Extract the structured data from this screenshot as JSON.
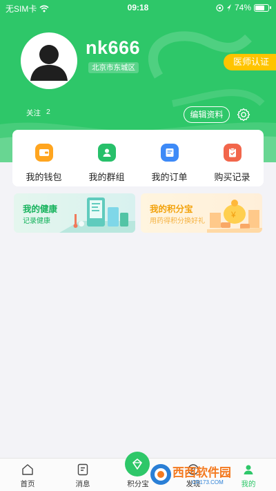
{
  "status_bar": {
    "carrier": "无SIM卡",
    "time": "09:18",
    "battery_percent": "74%",
    "battery_level": 0.74
  },
  "profile": {
    "username": "nk666",
    "location": "北京市东城区",
    "doctor_badge": "医师认证",
    "follow_label": "关注",
    "follow_count": "2",
    "edit_label": "编辑资料"
  },
  "menu": {
    "items": [
      {
        "label": "我的钱包",
        "icon": "wallet-icon",
        "color": "#ffa51f"
      },
      {
        "label": "我的群组",
        "icon": "group-icon",
        "color": "#27c06a"
      },
      {
        "label": "我的订单",
        "icon": "order-icon",
        "color": "#3d8af7"
      },
      {
        "label": "购买记录",
        "icon": "purchase-record-icon",
        "color": "#f2664b"
      }
    ]
  },
  "promos": {
    "health": {
      "title": "我的健康",
      "subtitle": "记录健康"
    },
    "points": {
      "title": "我的积分宝",
      "subtitle": "用药得积分换好礼"
    }
  },
  "tabs": [
    {
      "label": "首页",
      "icon": "home-icon",
      "active": false
    },
    {
      "label": "消息",
      "icon": "message-icon",
      "active": false
    },
    {
      "label": "积分宝",
      "icon": "points-icon",
      "active": false
    },
    {
      "label": "发现",
      "icon": "discover-icon",
      "active": false
    },
    {
      "label": "我的",
      "icon": "profile-icon",
      "active": true
    }
  ],
  "watermark": {
    "brand": "西西软件园",
    "url": "CR173.COM"
  },
  "colors": {
    "primary": "#2ec769",
    "badge": "#ffc400",
    "points": "#f2a20b"
  }
}
